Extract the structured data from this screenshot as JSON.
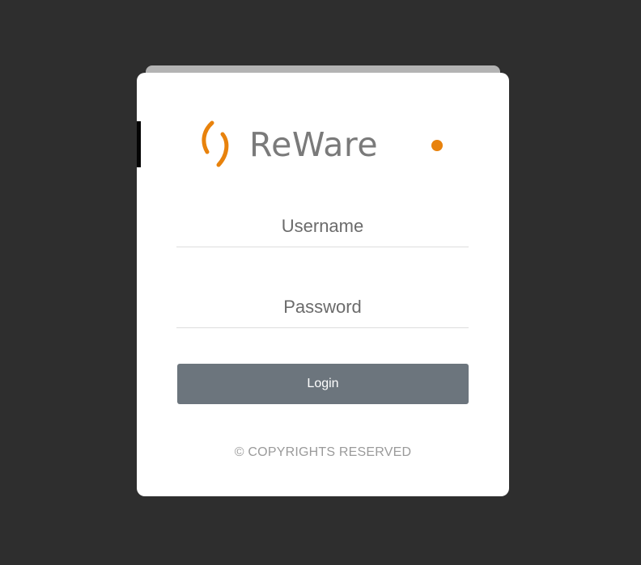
{
  "logo": {
    "text": "ReWare",
    "accent_color": "#e8820c",
    "text_color": "#7a7a7a"
  },
  "form": {
    "username_placeholder": "Username",
    "password_placeholder": "Password",
    "username_value": "",
    "password_value": "",
    "login_label": "Login"
  },
  "footer": {
    "copyright": "© COPYRIGHTS RESERVED"
  },
  "colors": {
    "background": "#2e2e2e",
    "card": "#ffffff",
    "button": "#6c757d"
  }
}
